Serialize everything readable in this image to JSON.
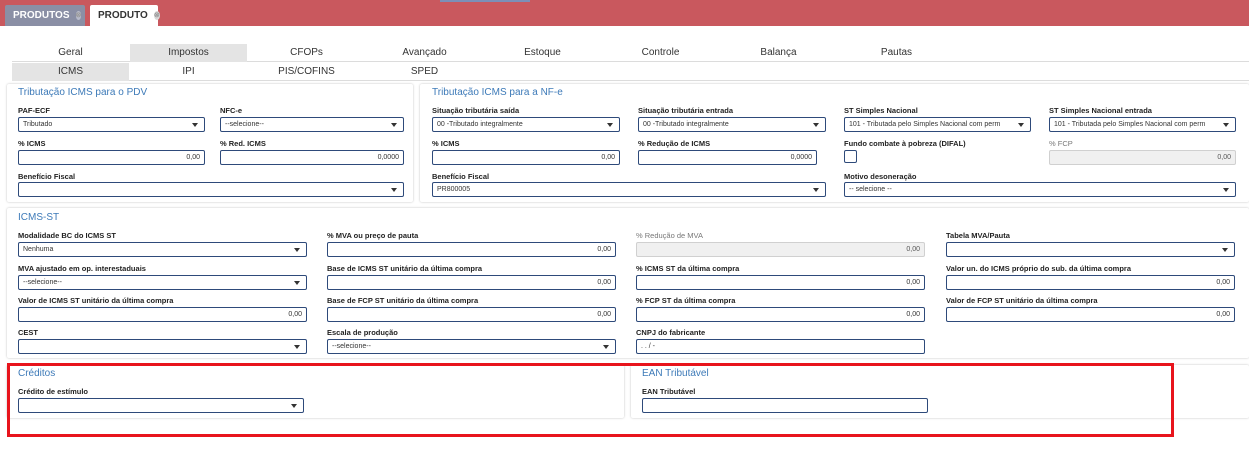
{
  "topbar": {
    "tabs": [
      {
        "label": "PRODUTOS"
      },
      {
        "label": "PRODUTO"
      }
    ],
    "close_glyph": "⊗"
  },
  "nav": {
    "main": [
      "Geral",
      "Impostos",
      "CFOPs",
      "Avançado",
      "Estoque",
      "Controle",
      "Balança",
      "Pautas"
    ],
    "sub": [
      "ICMS",
      "IPI",
      "PIS/COFINS",
      "SPED"
    ]
  },
  "pdv": {
    "title": "Tributação ICMS para o PDV",
    "paf_label": "PAF-ECF",
    "paf_value": "Tributado",
    "nfce_label": "NFC-e",
    "nfce_value": "--selecione--",
    "icms_label": "% ICMS",
    "icms_value": "0,00",
    "red_label": "% Red. ICMS",
    "red_value": "0,0000",
    "benef_label": "Benefício Fiscal",
    "benef_value": ""
  },
  "nfe": {
    "title": "Tributação ICMS para a NF-e",
    "sit_saida_label": "Situação tributária saída",
    "sit_saida_value": "00 -Tributado integralmente",
    "sit_entrada_label": "Situação tributária entrada",
    "sit_entrada_value": "00 -Tributado integralmente",
    "st_simples_label": "ST Simples Nacional",
    "st_simples_value": "101 - Tributada pelo Simples Nacional com perm",
    "st_simples_ent_label": "ST Simples Nacional entrada",
    "st_simples_ent_value": "101 - Tributada pelo Simples Nacional com perm",
    "icms_label": "% ICMS",
    "icms_value": "0,00",
    "red_label": "% Redução de ICMS",
    "red_value": "0,0000",
    "fcp_label": "Fundo combate à pobreza (DIFAL)",
    "pfcp_label": "% FCP",
    "pfcp_value": "0,00",
    "benef_label": "Benefício Fiscal",
    "benef_value": "PR800005",
    "motivo_label": "Motivo desoneração",
    "motivo_value": "-- selecione --"
  },
  "st": {
    "title": "ICMS-ST",
    "mod_label": "Modalidade BC do ICMS ST",
    "mod_value": "Nenhuma",
    "mva_label": "% MVA ou preço de pauta",
    "mva_value": "0,00",
    "redmva_label": "% Redução de MVA",
    "redmva_value": "0,00",
    "tab_label": "Tabela MVA/Pauta",
    "tab_value": "",
    "mvaaj_label": "MVA ajustado em op. interestaduais",
    "mvaaj_value": "--selecione--",
    "base_label": "Base de ICMS ST unitário da última compra",
    "base_value": "0,00",
    "pst_label": "% ICMS ST da última compra",
    "pst_value": "0,00",
    "valun_label": "Valor un. do ICMS próprio do sub. da última compra",
    "valun_value": "0,00",
    "valst_label": "Valor de ICMS ST unitário da última compra",
    "valst_value": "0,00",
    "basefcp_label": "Base de FCP ST unitário da última compra",
    "basefcp_value": "0,00",
    "pfcp_label": "% FCP ST da última compra",
    "pfcp_value": "0,00",
    "valfcp_label": "Valor de FCP ST unitário da última compra",
    "valfcp_value": "0,00",
    "cest_label": "CEST",
    "cest_value": "",
    "escala_label": "Escala de produção",
    "escala_value": "--selecione--",
    "cnpj_label": "CNPJ do fabricante",
    "cnpj_value": ". . / -"
  },
  "creditos": {
    "title": "Créditos",
    "cred_label": "Crédito de estímulo",
    "cred_value": ""
  },
  "ean": {
    "title": "EAN Tributável",
    "ean_label": "EAN Tributável",
    "ean_value": ""
  },
  "colors": {
    "topbar": "#c9585e",
    "accent": "#3d7ab8",
    "highlight": "#e8141c"
  }
}
